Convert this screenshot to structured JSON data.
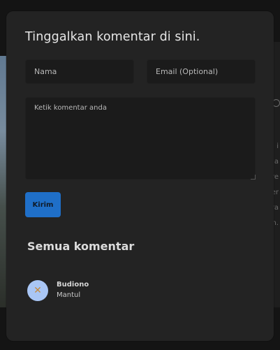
{
  "background": {
    "right_chars": [
      "i",
      "da",
      "re",
      "er",
      "ra",
      "n."
    ]
  },
  "modal": {
    "title": "Tinggalkan komentar di sini.",
    "form": {
      "name_placeholder": "Nama",
      "email_placeholder": "Email (Optional)",
      "comment_placeholder": "Ketik komentar anda",
      "submit_label": "Kirim"
    },
    "comments_section": {
      "title": "Semua komentar",
      "comments": [
        {
          "author": "Budiono",
          "text": "Mantul",
          "avatar_icon": "close-icon"
        }
      ]
    }
  },
  "colors": {
    "modal_bg": "#232323",
    "input_bg": "#1b1b1b",
    "submit_bg": "#1f6fc8",
    "avatar_bg": "#a9c6f5",
    "avatar_icon": "#c58a3c"
  }
}
